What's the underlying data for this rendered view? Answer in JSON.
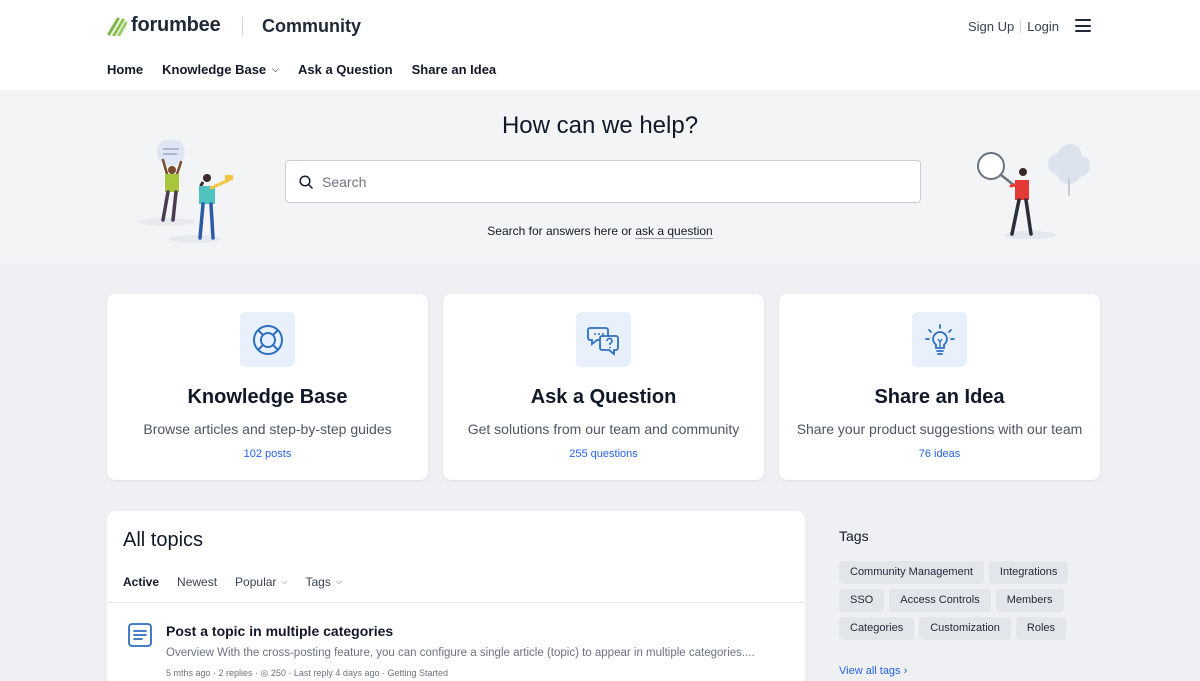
{
  "header": {
    "brand": "forumbee",
    "section": "Community",
    "signup": "Sign Up",
    "login": "Login"
  },
  "nav": [
    {
      "label": "Home"
    },
    {
      "label": "Knowledge Base"
    },
    {
      "label": "Ask a Question"
    },
    {
      "label": "Share an Idea"
    }
  ],
  "hero": {
    "title": "How can we help?",
    "search_placeholder": "Search",
    "sub_prefix": "Search for answers here or",
    "sub_link": "ask a question"
  },
  "cards": [
    {
      "title": "Knowledge Base",
      "desc": "Browse articles and step-by-step guides",
      "count": "102 posts",
      "icon": "lifebuoy-icon"
    },
    {
      "title": "Ask a Question",
      "desc": "Get solutions from our team and community",
      "count": "255 questions",
      "icon": "chat-question-icon"
    },
    {
      "title": "Share an Idea",
      "desc": "Share your product suggestions with our team",
      "count": "76 ideas",
      "icon": "lightbulb-icon"
    }
  ],
  "topics": {
    "title": "All topics",
    "tabs": [
      {
        "label": "Active"
      },
      {
        "label": "Newest"
      },
      {
        "label": "Popular"
      },
      {
        "label": "Tags"
      }
    ],
    "items": [
      {
        "title": "Post a topic in multiple categories",
        "excerpt": "Overview With the cross-posting feature, you can configure a single article (topic) to appear in multiple categories....",
        "meta": "5 mths ago · 2 replies · ◎ 250 · Last reply 4 days ago · Getting Started"
      }
    ]
  },
  "tags": {
    "title": "Tags",
    "rows": [
      [
        "Community Management",
        "Integrations"
      ],
      [
        "SSO",
        "Access Controls",
        "Members"
      ],
      [
        "Categories",
        "Customization",
        "Roles"
      ]
    ],
    "view_all": "View all tags ›"
  },
  "colors": {
    "accent": "#2563eb",
    "brand_green": "#7cb342",
    "icon_bg": "#e7f0fb"
  }
}
